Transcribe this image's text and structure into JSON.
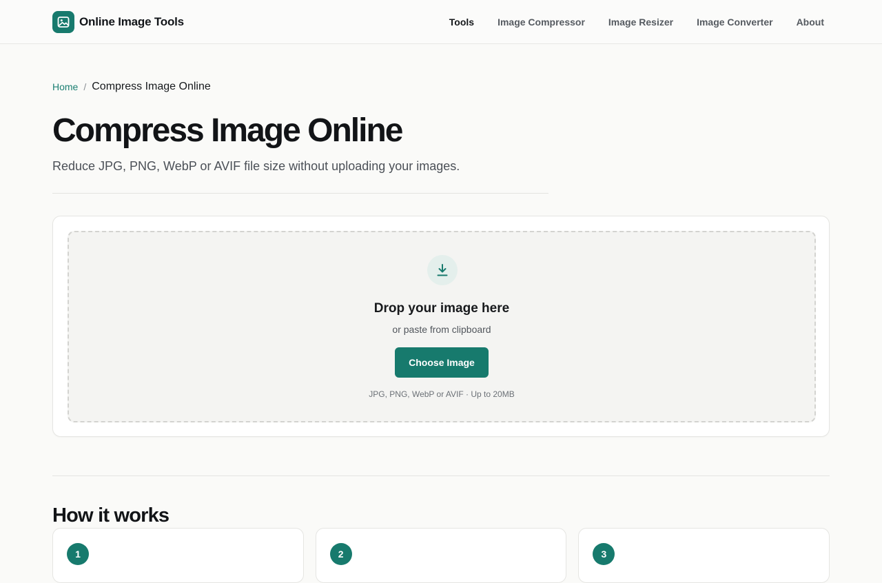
{
  "brand": {
    "name": "Online Image Tools",
    "icon": "image-icon",
    "color": "#177a6d"
  },
  "nav": {
    "items": [
      {
        "label": "Tools",
        "active": true
      },
      {
        "label": "Image Compressor",
        "active": false
      },
      {
        "label": "Image Resizer",
        "active": false
      },
      {
        "label": "Image Converter",
        "active": false
      },
      {
        "label": "About",
        "active": false
      }
    ]
  },
  "breadcrumb": {
    "home": "Home",
    "separator": "/",
    "current": "Compress Image Online"
  },
  "page": {
    "title": "Compress Image Online",
    "subtitle": "Reduce JPG, PNG, WebP or AVIF file size without uploading your images."
  },
  "upload": {
    "icon": "download-arrow-icon",
    "title": "Drop your image here",
    "subtitle": "or paste from clipboard",
    "button_label": "Choose Image",
    "hint": "JPG, PNG, WebP or AVIF · Up to 20MB"
  },
  "how_it_works": {
    "title": "How it works",
    "steps": [
      {
        "number": "1"
      },
      {
        "number": "2"
      },
      {
        "number": "3"
      }
    ]
  },
  "colors": {
    "accent": "#177a6d",
    "accent_light": "#e4efec",
    "link": "#1b7f72"
  }
}
